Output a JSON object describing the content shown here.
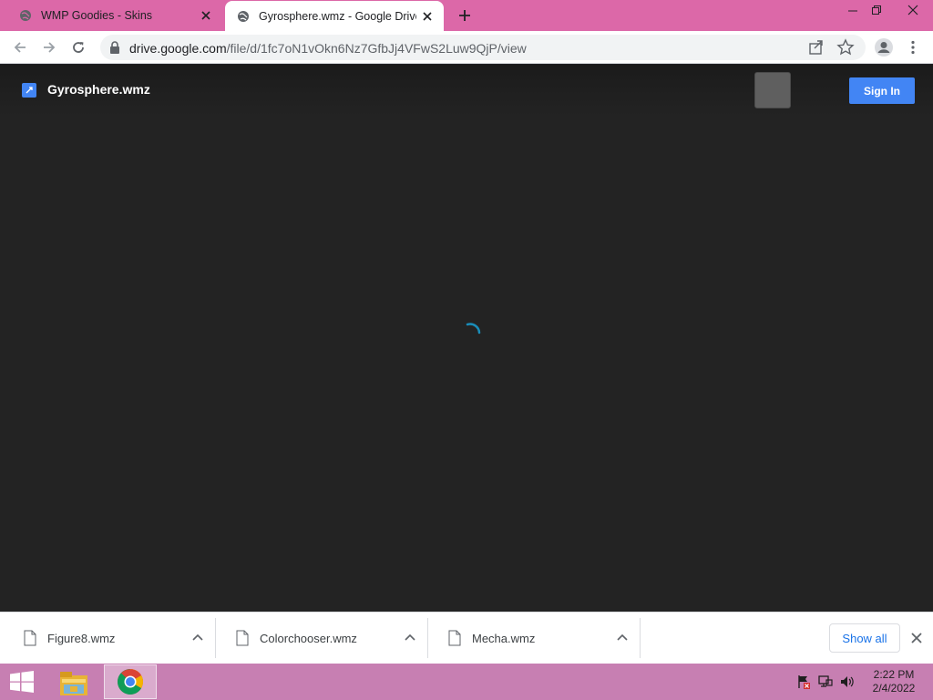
{
  "browser": {
    "tabs": [
      {
        "title": "WMP Goodies - Skins",
        "active": false
      },
      {
        "title": "Gyrosphere.wmz - Google Drive",
        "active": true
      }
    ],
    "address": {
      "host": "drive.google.com",
      "path": "/file/d/1fc7oN1vOkn6Nz7GfbJj4VFwS2Luw9QjP/view"
    }
  },
  "viewer": {
    "file_name": "Gyrosphere.wmz",
    "sign_in_label": "Sign In",
    "loading": true
  },
  "downloads": {
    "items": [
      {
        "name": "Figure8.wmz"
      },
      {
        "name": "Colorchooser.wmz"
      },
      {
        "name": "Mecha.wmz"
      }
    ],
    "show_all_label": "Show all"
  },
  "taskbar": {
    "time": "2:22 PM",
    "date": "2/4/2022"
  },
  "colors": {
    "tab_strip": "#dc68a8",
    "taskbar": "#c77fb2",
    "viewer_bg": "#232323",
    "accent": "#4285f4"
  }
}
